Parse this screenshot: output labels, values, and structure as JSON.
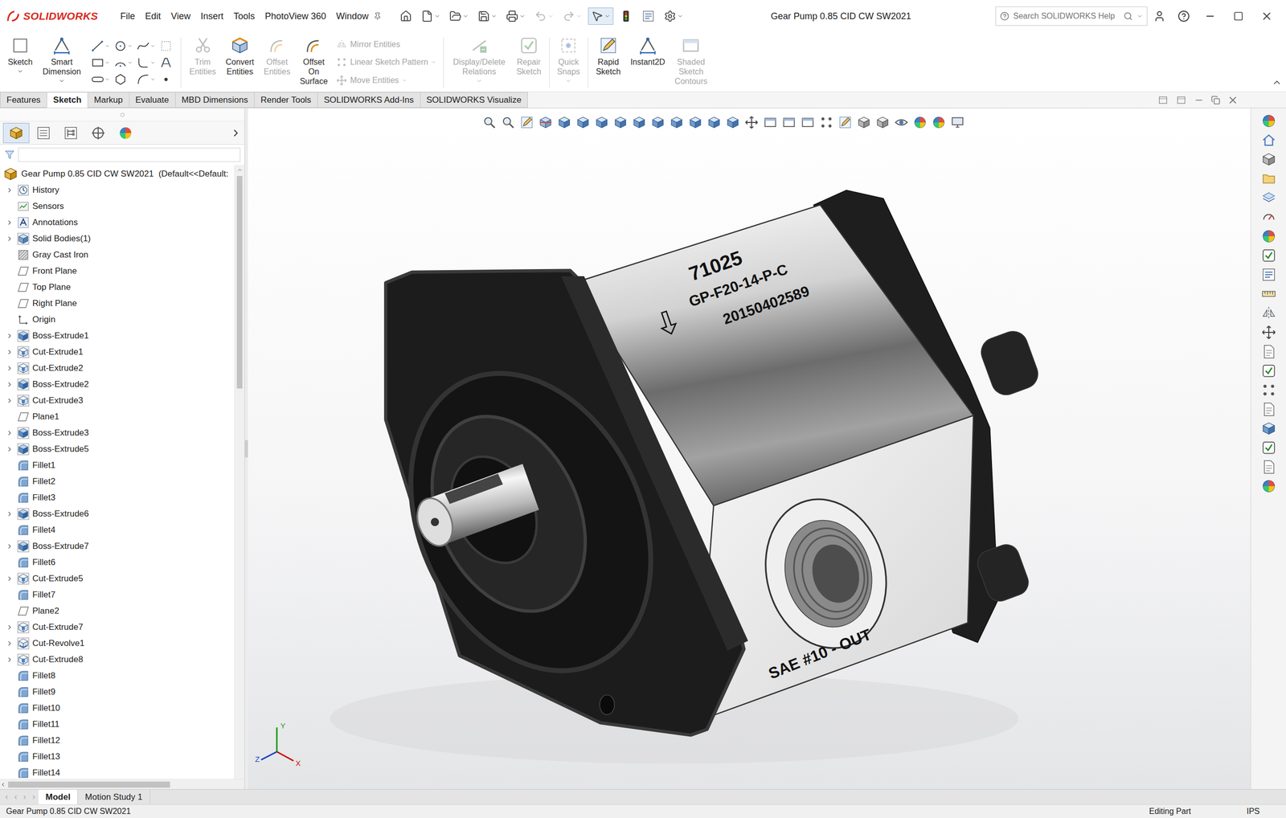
{
  "window": {
    "title": "Gear Pump 0.85 CID CW SW2021"
  },
  "logo": {
    "name": "SOLIDWORKS"
  },
  "menu": [
    "File",
    "Edit",
    "View",
    "Insert",
    "Tools",
    "PhotoView 360",
    "Window"
  ],
  "search": {
    "placeholder": "Search SOLIDWORKS Help"
  },
  "ribbon": {
    "primary": [
      {
        "label": "Sketch",
        "kind": "sketch",
        "disabled": false
      },
      {
        "label": "Smart Dimension",
        "kind": "dimension",
        "disabled": false
      }
    ],
    "entities": [
      {
        "label": "Trim Entities",
        "kind": "trim",
        "disabled": true
      },
      {
        "label": "Convert Entities",
        "kind": "convert",
        "disabled": false
      },
      {
        "label": "Offset Entities",
        "kind": "offset",
        "disabled": true
      },
      {
        "label": "Offset On Surface",
        "kind": "offset",
        "disabled": false
      }
    ],
    "small": [
      {
        "label": "Mirror Entities",
        "kind": "mirror",
        "disabled": true
      },
      {
        "label": "Linear Sketch Pattern",
        "kind": "grid",
        "disabled": true
      },
      {
        "label": "Move Entities",
        "kind": "move",
        "disabled": true
      }
    ],
    "relations": [
      {
        "label": "Display/Delete Relations",
        "kind": "relations",
        "disabled": true
      },
      {
        "label": "Repair Sketch",
        "kind": "check",
        "disabled": true
      },
      {
        "label": "Quick Snaps",
        "kind": "snap",
        "disabled": true
      },
      {
        "label": "Rapid Sketch",
        "kind": "pencil",
        "disabled": false
      },
      {
        "label": "Instant2D",
        "kind": "dimension",
        "disabled": false
      },
      {
        "label": "Shaded Sketch Contours",
        "kind": "rect",
        "disabled": true
      }
    ]
  },
  "command_tabs": [
    {
      "label": "Features",
      "selected": false
    },
    {
      "label": "Sketch",
      "selected": true
    },
    {
      "label": "Markup",
      "selected": false
    },
    {
      "label": "Evaluate",
      "selected": false
    },
    {
      "label": "MBD Dimensions",
      "selected": false
    },
    {
      "label": "Render Tools",
      "selected": false
    },
    {
      "label": "SOLIDWORKS Add-Ins",
      "selected": false
    },
    {
      "label": "SOLIDWORKS Visualize",
      "selected": false
    }
  ],
  "panel_tabs": [
    {
      "kind": "feature-manager",
      "selected": true
    },
    {
      "kind": "property-manager",
      "selected": false
    },
    {
      "kind": "configuration-manager",
      "selected": false
    },
    {
      "kind": "dimxpert-manager",
      "selected": false
    },
    {
      "kind": "display-manager",
      "selected": false
    }
  ],
  "feature_tree": {
    "root": "Gear Pump 0.85 CID CW SW2021  (Default<<Default:",
    "items": [
      {
        "label": "History",
        "kind": "history",
        "expandable": true
      },
      {
        "label": "Sensors",
        "kind": "sensor",
        "expandable": false
      },
      {
        "label": "Annotations",
        "kind": "annotation",
        "expandable": true
      },
      {
        "label": "Solid Bodies(1)",
        "kind": "body",
        "expandable": true
      },
      {
        "label": "Gray Cast Iron",
        "kind": "material",
        "expandable": false
      },
      {
        "label": "Front Plane",
        "kind": "plane",
        "expandable": false
      },
      {
        "label": "Top Plane",
        "kind": "plane",
        "expandable": false
      },
      {
        "label": "Right Plane",
        "kind": "plane",
        "expandable": false
      },
      {
        "label": "Origin",
        "kind": "origin",
        "expandable": false
      },
      {
        "label": "Boss-Extrude1",
        "kind": "boss",
        "expandable": true
      },
      {
        "label": "Cut-Extrude1",
        "kind": "cut",
        "expandable": true
      },
      {
        "label": "Cut-Extrude2",
        "kind": "cut",
        "expandable": true
      },
      {
        "label": "Boss-Extrude2",
        "kind": "boss",
        "expandable": true
      },
      {
        "label": "Cut-Extrude3",
        "kind": "cut",
        "expandable": true
      },
      {
        "label": "Plane1",
        "kind": "plane",
        "expandable": false
      },
      {
        "label": "Boss-Extrude3",
        "kind": "boss",
        "expandable": true
      },
      {
        "label": "Boss-Extrude5",
        "kind": "boss",
        "expandable": true
      },
      {
        "label": "Fillet1",
        "kind": "fillet",
        "expandable": false
      },
      {
        "label": "Fillet2",
        "kind": "fillet",
        "expandable": false
      },
      {
        "label": "Fillet3",
        "kind": "fillet",
        "expandable": false
      },
      {
        "label": "Boss-Extrude6",
        "kind": "boss",
        "expandable": true
      },
      {
        "label": "Fillet4",
        "kind": "fillet",
        "expandable": false
      },
      {
        "label": "Boss-Extrude7",
        "kind": "boss",
        "expandable": true
      },
      {
        "label": "Fillet6",
        "kind": "fillet",
        "expandable": false
      },
      {
        "label": "Cut-Extrude5",
        "kind": "cut",
        "expandable": true
      },
      {
        "label": "Fillet7",
        "kind": "fillet",
        "expandable": false
      },
      {
        "label": "Plane2",
        "kind": "plane",
        "expandable": false
      },
      {
        "label": "Cut-Extrude7",
        "kind": "cut",
        "expandable": true
      },
      {
        "label": "Cut-Revolve1",
        "kind": "revolve",
        "expandable": true
      },
      {
        "label": "Cut-Extrude8",
        "kind": "cut",
        "expandable": true
      },
      {
        "label": "Fillet8",
        "kind": "fillet",
        "expandable": false
      },
      {
        "label": "Fillet9",
        "kind": "fillet",
        "expandable": false
      },
      {
        "label": "Fillet10",
        "kind": "fillet",
        "expandable": false
      },
      {
        "label": "Fillet11",
        "kind": "fillet",
        "expandable": false
      },
      {
        "label": "Fillet12",
        "kind": "fillet",
        "expandable": false
      },
      {
        "label": "Fillet13",
        "kind": "fillet",
        "expandable": false
      },
      {
        "label": "Fillet14",
        "kind": "fillet",
        "expandable": false
      }
    ]
  },
  "model": {
    "part_number": "71025",
    "model_code": "GP-F20-14-P-C",
    "serial": "20150402589",
    "port_label": "SAE #10 - OUT"
  },
  "triad": {
    "x": "X",
    "y": "Y",
    "z": "Z"
  },
  "bottom_tabs": [
    {
      "label": "Model",
      "selected": true
    },
    {
      "label": "Motion Study 1",
      "selected": false
    }
  ],
  "status_bar": {
    "document": "Gear Pump 0.85 CID CW SW2021",
    "mode": "Editing Part",
    "units": "IPS"
  }
}
